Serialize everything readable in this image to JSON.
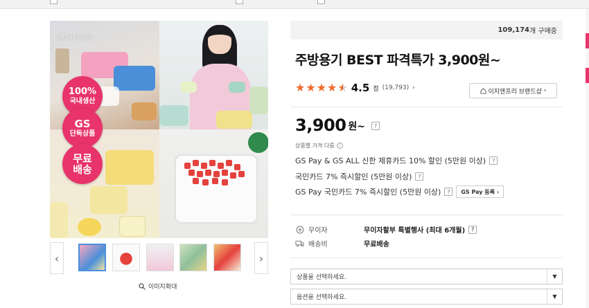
{
  "gallery": {
    "brand_tag": "EASY&FREE",
    "badges": [
      {
        "big": "100%",
        "small": "국내생산"
      },
      {
        "big": "GS",
        "small": "단독상품"
      },
      {
        "big": "",
        "small": "무료\n배송"
      }
    ],
    "prev_label": "‹",
    "next_label": "›",
    "zoom_label": "이미지확대",
    "zoom_icon": "magnifier-icon"
  },
  "product": {
    "buyers_count": "109,174",
    "buyers_suffix": "개 구매중",
    "title": "주방용기 BEST 파격특가 3,900원~",
    "rating": {
      "score": "4.5",
      "unit": "점",
      "count": "(19,793)",
      "stars_value": 4.5,
      "stars_max": 5,
      "arrow": "›"
    },
    "brand_button": "이지앤프리 브랜드샵",
    "price": "3,900",
    "price_unit": "원~",
    "price_note": "상품별 가격 다름",
    "discounts": [
      "GS Pay & GS ALL 신한 제휴카드 10% 할인 (5만원 이상)",
      "국민카드 7% 즉시할인 (5만원 이상)",
      "GS Pay 국민카드 7% 즉시할인 (5만원 이상)"
    ],
    "gspay_button": "GS Pay 등록",
    "installment_label": "무이자",
    "installment_value": "무이자할부 특별행사 (최대 6개월)",
    "shipping_label": "배송비",
    "shipping_value": "무료배송",
    "select_product_placeholder": "상품을 선택하세요.",
    "select_option_placeholder": "옵션을 선택하세요."
  },
  "colors": {
    "accent": "#e8336b",
    "star": "#f06a2c"
  }
}
